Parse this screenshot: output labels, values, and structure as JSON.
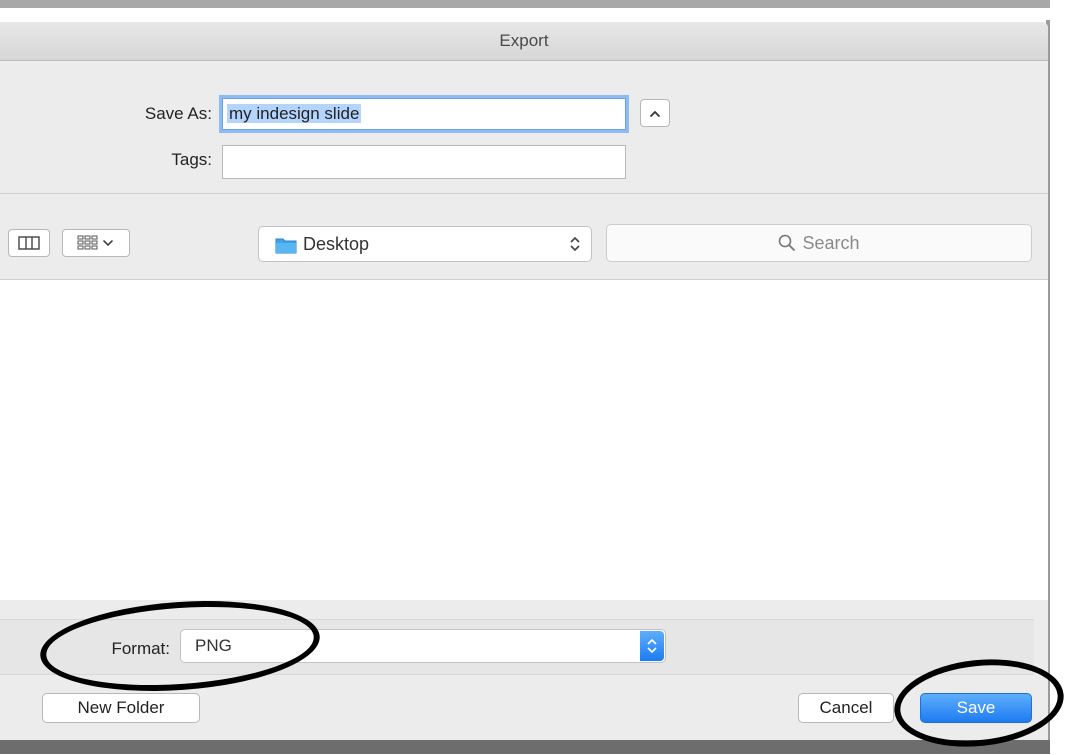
{
  "dialog": {
    "title": "Export"
  },
  "save_as": {
    "label": "Save As:",
    "value": "my indesign slide"
  },
  "tags": {
    "label": "Tags:",
    "value": ""
  },
  "location": {
    "selected": "Desktop"
  },
  "search": {
    "placeholder": "Search"
  },
  "format": {
    "label": "Format:",
    "selected": "PNG"
  },
  "buttons": {
    "new_folder": "New Folder",
    "cancel": "Cancel",
    "save": "Save"
  },
  "colors": {
    "accent": "#1e7cf2",
    "folder": "#3ea3e8",
    "selection": "#b3d4fc",
    "annotation": "#000000"
  },
  "icons": {
    "collapse": "chevron-up-icon",
    "column_view": "column-view-icon",
    "group_view": "group-view-icon",
    "folder": "folder-icon",
    "search": "magnifier-icon",
    "popup_arrows": "up-down-arrows-icon"
  }
}
